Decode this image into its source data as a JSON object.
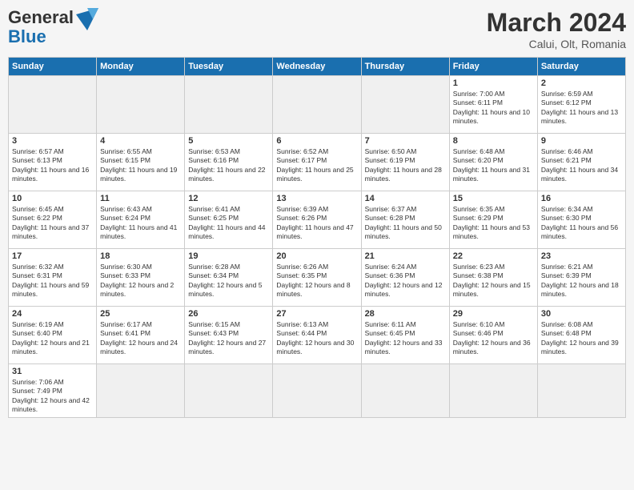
{
  "header": {
    "logo_general": "General",
    "logo_blue": "Blue",
    "month_title": "March 2024",
    "location": "Calui, Olt, Romania"
  },
  "weekdays": [
    "Sunday",
    "Monday",
    "Tuesday",
    "Wednesday",
    "Thursday",
    "Friday",
    "Saturday"
  ],
  "weeks": [
    [
      {
        "day": "",
        "empty": true
      },
      {
        "day": "",
        "empty": true
      },
      {
        "day": "",
        "empty": true
      },
      {
        "day": "",
        "empty": true
      },
      {
        "day": "",
        "empty": true
      },
      {
        "day": "1",
        "sunrise": "7:00 AM",
        "sunset": "6:11 PM",
        "daylight": "11 hours and 10 minutes."
      },
      {
        "day": "2",
        "sunrise": "6:59 AM",
        "sunset": "6:12 PM",
        "daylight": "11 hours and 13 minutes."
      }
    ],
    [
      {
        "day": "3",
        "sunrise": "6:57 AM",
        "sunset": "6:13 PM",
        "daylight": "11 hours and 16 minutes."
      },
      {
        "day": "4",
        "sunrise": "6:55 AM",
        "sunset": "6:15 PM",
        "daylight": "11 hours and 19 minutes."
      },
      {
        "day": "5",
        "sunrise": "6:53 AM",
        "sunset": "6:16 PM",
        "daylight": "11 hours and 22 minutes."
      },
      {
        "day": "6",
        "sunrise": "6:52 AM",
        "sunset": "6:17 PM",
        "daylight": "11 hours and 25 minutes."
      },
      {
        "day": "7",
        "sunrise": "6:50 AM",
        "sunset": "6:19 PM",
        "daylight": "11 hours and 28 minutes."
      },
      {
        "day": "8",
        "sunrise": "6:48 AM",
        "sunset": "6:20 PM",
        "daylight": "11 hours and 31 minutes."
      },
      {
        "day": "9",
        "sunrise": "6:46 AM",
        "sunset": "6:21 PM",
        "daylight": "11 hours and 34 minutes."
      }
    ],
    [
      {
        "day": "10",
        "sunrise": "6:45 AM",
        "sunset": "6:22 PM",
        "daylight": "11 hours and 37 minutes."
      },
      {
        "day": "11",
        "sunrise": "6:43 AM",
        "sunset": "6:24 PM",
        "daylight": "11 hours and 41 minutes."
      },
      {
        "day": "12",
        "sunrise": "6:41 AM",
        "sunset": "6:25 PM",
        "daylight": "11 hours and 44 minutes."
      },
      {
        "day": "13",
        "sunrise": "6:39 AM",
        "sunset": "6:26 PM",
        "daylight": "11 hours and 47 minutes."
      },
      {
        "day": "14",
        "sunrise": "6:37 AM",
        "sunset": "6:28 PM",
        "daylight": "11 hours and 50 minutes."
      },
      {
        "day": "15",
        "sunrise": "6:35 AM",
        "sunset": "6:29 PM",
        "daylight": "11 hours and 53 minutes."
      },
      {
        "day": "16",
        "sunrise": "6:34 AM",
        "sunset": "6:30 PM",
        "daylight": "11 hours and 56 minutes."
      }
    ],
    [
      {
        "day": "17",
        "sunrise": "6:32 AM",
        "sunset": "6:31 PM",
        "daylight": "11 hours and 59 minutes."
      },
      {
        "day": "18",
        "sunrise": "6:30 AM",
        "sunset": "6:33 PM",
        "daylight": "12 hours and 2 minutes."
      },
      {
        "day": "19",
        "sunrise": "6:28 AM",
        "sunset": "6:34 PM",
        "daylight": "12 hours and 5 minutes."
      },
      {
        "day": "20",
        "sunrise": "6:26 AM",
        "sunset": "6:35 PM",
        "daylight": "12 hours and 8 minutes."
      },
      {
        "day": "21",
        "sunrise": "6:24 AM",
        "sunset": "6:36 PM",
        "daylight": "12 hours and 12 minutes."
      },
      {
        "day": "22",
        "sunrise": "6:23 AM",
        "sunset": "6:38 PM",
        "daylight": "12 hours and 15 minutes."
      },
      {
        "day": "23",
        "sunrise": "6:21 AM",
        "sunset": "6:39 PM",
        "daylight": "12 hours and 18 minutes."
      }
    ],
    [
      {
        "day": "24",
        "sunrise": "6:19 AM",
        "sunset": "6:40 PM",
        "daylight": "12 hours and 21 minutes."
      },
      {
        "day": "25",
        "sunrise": "6:17 AM",
        "sunset": "6:41 PM",
        "daylight": "12 hours and 24 minutes."
      },
      {
        "day": "26",
        "sunrise": "6:15 AM",
        "sunset": "6:43 PM",
        "daylight": "12 hours and 27 minutes."
      },
      {
        "day": "27",
        "sunrise": "6:13 AM",
        "sunset": "6:44 PM",
        "daylight": "12 hours and 30 minutes."
      },
      {
        "day": "28",
        "sunrise": "6:11 AM",
        "sunset": "6:45 PM",
        "daylight": "12 hours and 33 minutes."
      },
      {
        "day": "29",
        "sunrise": "6:10 AM",
        "sunset": "6:46 PM",
        "daylight": "12 hours and 36 minutes."
      },
      {
        "day": "30",
        "sunrise": "6:08 AM",
        "sunset": "6:48 PM",
        "daylight": "12 hours and 39 minutes."
      }
    ],
    [
      {
        "day": "31",
        "sunrise": "7:06 AM",
        "sunset": "7:49 PM",
        "daylight": "12 hours and 42 minutes."
      },
      {
        "day": "",
        "empty": true
      },
      {
        "day": "",
        "empty": true
      },
      {
        "day": "",
        "empty": true
      },
      {
        "day": "",
        "empty": true
      },
      {
        "day": "",
        "empty": true
      },
      {
        "day": "",
        "empty": true
      }
    ]
  ]
}
